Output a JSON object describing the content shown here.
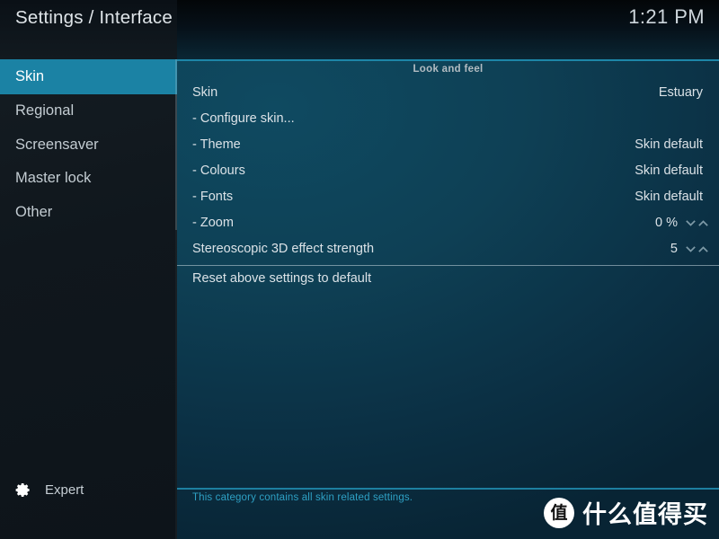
{
  "header": {
    "title": "Settings / Interface",
    "clock": "1:21 PM"
  },
  "sidebar": {
    "items": [
      {
        "label": "Skin",
        "selected": true
      },
      {
        "label": "Regional",
        "selected": false
      },
      {
        "label": "Screensaver",
        "selected": false
      },
      {
        "label": "Master lock",
        "selected": false
      },
      {
        "label": "Other",
        "selected": false
      }
    ],
    "level": {
      "label": "Expert",
      "icon": "gear-icon"
    }
  },
  "content": {
    "section_header": "Look and feel",
    "settings": [
      {
        "label": "Skin",
        "value": "Estuary",
        "spinner": false
      },
      {
        "label": "- Configure skin...",
        "value": "",
        "spinner": false
      },
      {
        "label": "- Theme",
        "value": "Skin default",
        "spinner": false
      },
      {
        "label": "- Colours",
        "value": "Skin default",
        "spinner": false
      },
      {
        "label": "- Fonts",
        "value": "Skin default",
        "spinner": false
      },
      {
        "label": "- Zoom",
        "value": "0 %",
        "spinner": true
      },
      {
        "label": "Stereoscopic 3D effect strength",
        "value": "5",
        "spinner": true
      }
    ],
    "reset": {
      "label": "Reset above settings to default"
    },
    "spinner_icons": {
      "down": "chevron-down-icon",
      "up": "chevron-up-icon"
    }
  },
  "status": {
    "text": "This category contains all skin related settings."
  },
  "watermark": {
    "badge": "值",
    "text": "什么值得买"
  },
  "colors": {
    "accent": "#1b82a4",
    "rule": "#1d86a8",
    "status_text": "#2ea0c4",
    "sidebar_bg": "#10171d",
    "content_bg": "#0e4055"
  }
}
